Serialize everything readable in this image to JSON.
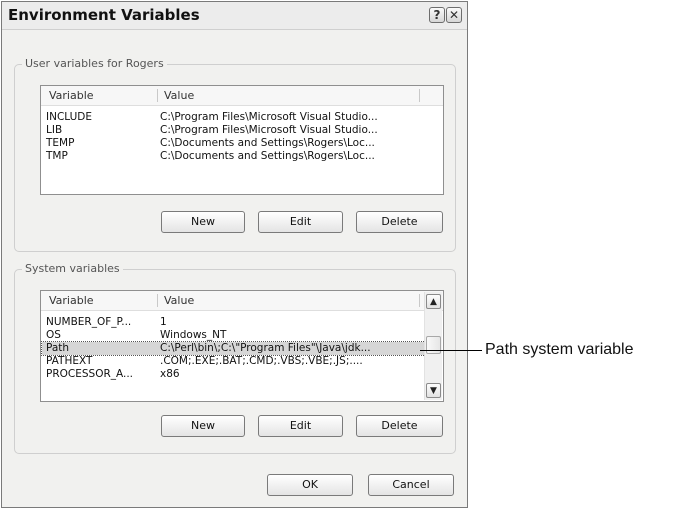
{
  "window": {
    "title": "Environment Variables",
    "help_glyph": "?",
    "close_glyph": "✕"
  },
  "user_group": {
    "label": "User variables for Rogers",
    "columns": [
      "Variable",
      "Value"
    ],
    "rows": [
      [
        "INCLUDE",
        "C:\\Program Files\\Microsoft Visual Studio..."
      ],
      [
        "LIB",
        "C:\\Program Files\\Microsoft Visual Studio..."
      ],
      [
        "TEMP",
        "C:\\Documents and Settings\\Rogers\\Loc..."
      ],
      [
        "TMP",
        "C:\\Documents and Settings\\Rogers\\Loc..."
      ]
    ],
    "buttons": {
      "new": "New",
      "edit": "Edit",
      "delete": "Delete"
    }
  },
  "system_group": {
    "label": "System variables",
    "columns": [
      "Variable",
      "Value"
    ],
    "rows": [
      [
        "NUMBER_OF_P...",
        "1"
      ],
      [
        "OS",
        "Windows_NT"
      ],
      [
        "Path",
        "C:\\Perl\\bin\\;C:\\\"Program Files\"\\Java\\jdk..."
      ],
      [
        "PATHEXT",
        ".COM;.EXE;.BAT;.CMD;.VBS;.VBE;.JS;...."
      ],
      [
        "PROCESSOR_A...",
        "x86"
      ]
    ],
    "selected_row": "Path",
    "scroll_up_glyph": "▲",
    "scroll_down_glyph": "▼",
    "buttons": {
      "new": "New",
      "edit": "Edit",
      "delete": "Delete"
    }
  },
  "footer": {
    "ok": "OK",
    "cancel": "Cancel"
  },
  "annotation": {
    "callout": "Path system variable"
  }
}
